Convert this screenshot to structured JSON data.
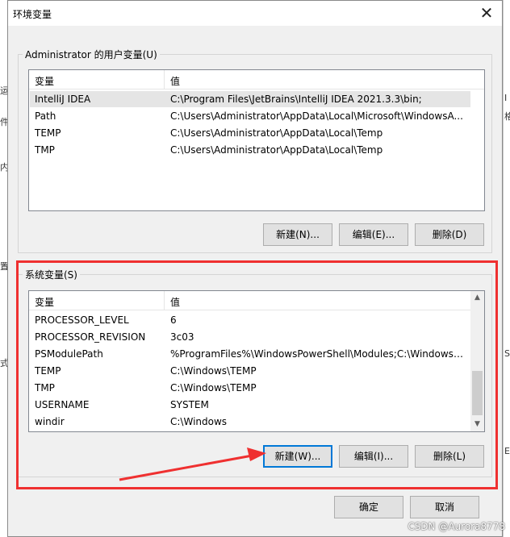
{
  "dialog": {
    "title": "环境变量",
    "close_label": "✕"
  },
  "background": {
    "left_fragments": [
      "运",
      "件",
      "内",
      "置",
      "式"
    ],
    "right_fragments": [
      "I",
      "格",
      "S",
      "E"
    ]
  },
  "user_vars": {
    "group_label": "Administrator 的用户变量(U)",
    "header_name": "变量",
    "header_value": "值",
    "rows": [
      {
        "name": "IntelliJ IDEA",
        "value": "C:\\Program Files\\JetBrains\\IntelliJ IDEA 2021.3.3\\bin;"
      },
      {
        "name": "Path",
        "value": "C:\\Users\\Administrator\\AppData\\Local\\Microsoft\\WindowsA..."
      },
      {
        "name": "TEMP",
        "value": "C:\\Users\\Administrator\\AppData\\Local\\Temp"
      },
      {
        "name": "TMP",
        "value": "C:\\Users\\Administrator\\AppData\\Local\\Temp"
      }
    ],
    "buttons": {
      "new": "新建(N)...",
      "edit": "编辑(E)...",
      "delete": "删除(D)"
    }
  },
  "system_vars": {
    "group_label": "系统变量(S)",
    "header_name": "变量",
    "header_value": "值",
    "rows": [
      {
        "name": "PROCESSOR_LEVEL",
        "value": "6"
      },
      {
        "name": "PROCESSOR_REVISION",
        "value": "3c03"
      },
      {
        "name": "PSModulePath",
        "value": "%ProgramFiles%\\WindowsPowerShell\\Modules;C:\\Windows\\..."
      },
      {
        "name": "TEMP",
        "value": "C:\\Windows\\TEMP"
      },
      {
        "name": "TMP",
        "value": "C:\\Windows\\TEMP"
      },
      {
        "name": "USERNAME",
        "value": "SYSTEM"
      },
      {
        "name": "windir",
        "value": "C:\\Windows"
      }
    ],
    "buttons": {
      "new": "新建(W)...",
      "edit": "编辑(I)...",
      "delete": "删除(L)"
    }
  },
  "footer": {
    "ok": "确定",
    "cancel": "取消"
  },
  "watermark": "CSDN @Aurora8778",
  "colors": {
    "highlight_box": "#ef3030",
    "focus_border": "#0078d7"
  }
}
